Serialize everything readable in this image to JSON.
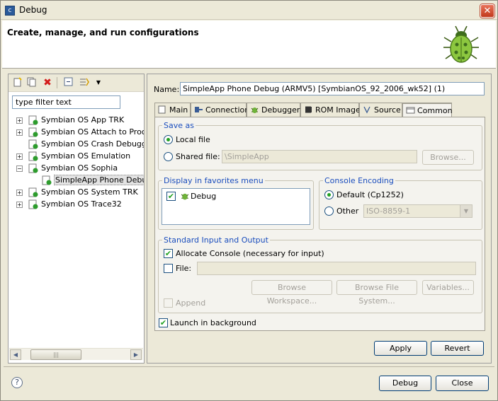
{
  "window": {
    "title": "Debug",
    "close_glyph": "✕"
  },
  "header": {
    "title": "Create, manage, and run configurations"
  },
  "left": {
    "filter_placeholder": "type filter text",
    "tree": [
      {
        "label": "Symbian OS App TRK",
        "expander": "+"
      },
      {
        "label": "Symbian OS Attach to Process",
        "expander": "+"
      },
      {
        "label": "Symbian OS Crash Debugger",
        "expander": ""
      },
      {
        "label": "Symbian OS Emulation",
        "expander": "+"
      },
      {
        "label": "Symbian OS Sophia",
        "expander": "−"
      },
      {
        "label": "SimpleApp Phone Debug",
        "expander": ""
      },
      {
        "label": "Symbian OS System TRK",
        "expander": "+"
      },
      {
        "label": "Symbian OS Trace32",
        "expander": "+"
      }
    ]
  },
  "config": {
    "name_label": "Name:",
    "name_value": "SimpleApp Phone Debug (ARMV5) [SymbianOS_92_2006_wk52] (1)",
    "tabs": [
      "Main",
      "Connection",
      "Debugger",
      "ROM Image",
      "Source",
      "Common"
    ],
    "save_as": {
      "title": "Save as",
      "local_label": "Local file",
      "shared_label": "Shared file:",
      "shared_value": "\\SimpleApp",
      "browse_label": "Browse..."
    },
    "favorites": {
      "title": "Display in favorites menu",
      "items": [
        {
          "label": "Debug",
          "checked": true
        }
      ]
    },
    "encoding": {
      "title": "Console Encoding",
      "default_label": "Default (Cp1252)",
      "other_label": "Other",
      "other_value": "ISO-8859-1"
    },
    "io": {
      "title": "Standard Input and Output",
      "allocate_label": "Allocate Console (necessary for input)",
      "file_label": "File:",
      "browse_workspace": "Browse Workspace...",
      "browse_fs": "Browse File System...",
      "variables": "Variables...",
      "append_label": "Append"
    },
    "background_label": "Launch in background",
    "apply_label": "Apply",
    "revert_label": "Revert"
  },
  "footer": {
    "debug_label": "Debug",
    "close_label": "Close",
    "help_glyph": "?"
  },
  "colors": {
    "group_title": "#1a4dbd",
    "check_green": "#21a121",
    "face": "#ece9d8"
  }
}
